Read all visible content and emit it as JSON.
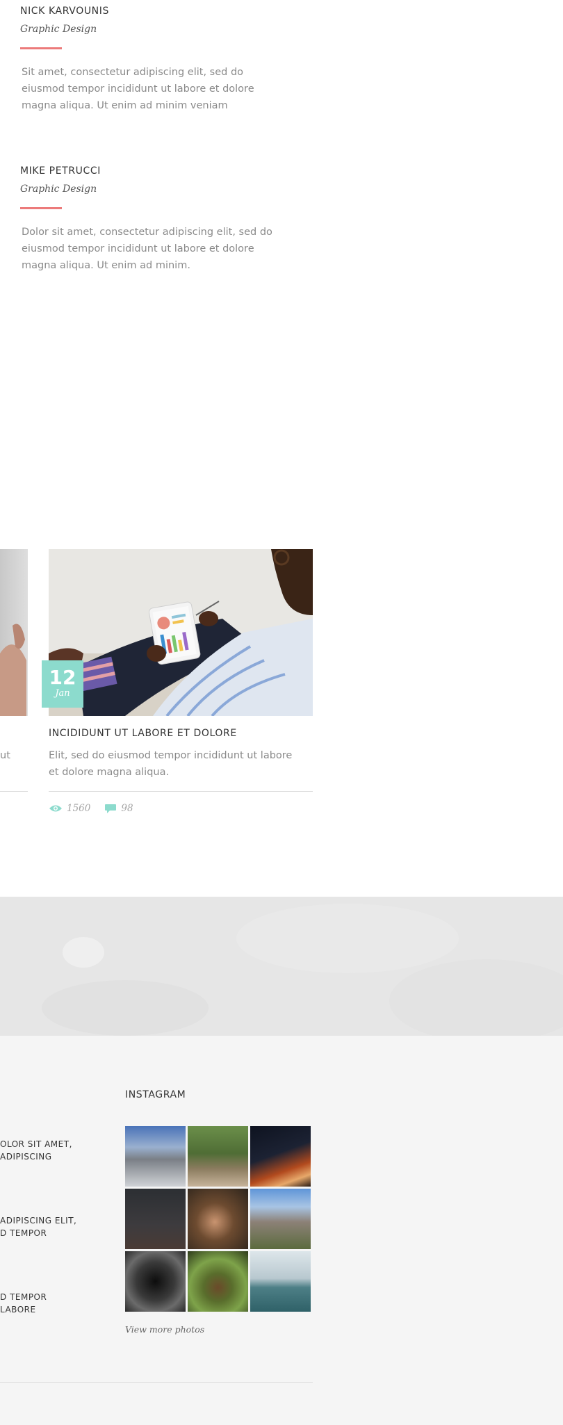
{
  "team": [
    {
      "name": "NICK KARVOUNIS",
      "role": "Graphic Design",
      "bio": "Sit amet, consectetur adipiscing elit, sed do eiusmod tempor incididunt ut labore et dolore magna aliqua. Ut enim ad minim veniam"
    },
    {
      "name": "MIKE PETRUCCI",
      "role": "Graphic Design",
      "bio": "Dolor sit amet, consectetur adipiscing elit, sed do eiusmod tempor incididunt ut labore et dolore magna aliqua. Ut enim ad minim."
    }
  ],
  "prev_post": {
    "text_fragment": "ut"
  },
  "post": {
    "day": "12",
    "month": "Jan",
    "title": "INCIDIDUNT UT LABORE ET DOLORE",
    "excerpt": "Elit, sed do eiusmod tempor incididunt ut labore et dolore magna aliqua.",
    "views": "1560",
    "comments": "98"
  },
  "footer": {
    "links": [
      {
        "line1": "OLOR SIT AMET,",
        "line2": "ADIPISCING"
      },
      {
        "line1": "ADIPISCING ELIT,",
        "line2": "D TEMPOR"
      },
      {
        "line1": "D TEMPOR",
        "line2": "LABORE"
      }
    ],
    "instagram_title": "INSTAGRAM",
    "view_more": "View more photos"
  },
  "colors": {
    "accent": "#8cdbcd",
    "red": "#ec7a7a"
  },
  "icons": {
    "views": "eye-icon",
    "comments": "speech-bubble-icon"
  }
}
